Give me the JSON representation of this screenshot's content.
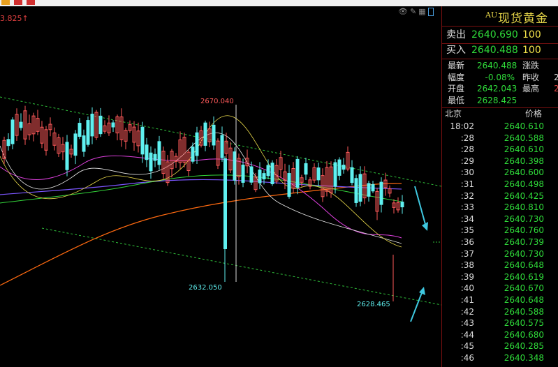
{
  "top_strip": {
    "colors": [
      "#e8a020",
      "#d03030",
      "#d03030"
    ]
  },
  "chart": {
    "top_left_label": "3.825↑",
    "high_label": "2670.040",
    "low_label": "2632.050",
    "low2_label": "2628.465",
    "toolbar_icons": [
      "eye-icon",
      "draw-icon",
      "grid-icon",
      "panel-icon"
    ]
  },
  "panel": {
    "code": "AU",
    "name": "现货黄金",
    "sell": {
      "label": "卖出",
      "price": "2640.690",
      "volume": "100"
    },
    "buy": {
      "label": "买入",
      "price": "2640.488",
      "volume": "100"
    },
    "stats": [
      {
        "l": "最新",
        "v": "2640.488",
        "vcolor": "#2fdc3a",
        "l2": "涨跌",
        "v2": "",
        "v2color": "#2fdc3a"
      },
      {
        "l": "幅度",
        "v": "-0.08%",
        "vcolor": "#2fdc3a",
        "l2": "昨收",
        "v2": "2",
        "v2color": "#dcdcdc"
      },
      {
        "l": "开盘",
        "v": "2642.043",
        "vcolor": "#2fdc3a",
        "l2": "最高",
        "v2": "2",
        "v2color": "#e04040"
      },
      {
        "l": "最低",
        "v": "2628.425",
        "vcolor": "#2fdc3a",
        "l2": "",
        "v2": "",
        "v2color": "#dcdcdc"
      }
    ],
    "table_header": {
      "city": "北京",
      "price": "价格"
    },
    "ticks": [
      {
        "time": "18:02",
        "price": "2640.610"
      },
      {
        "time": ":28",
        "price": "2640.588"
      },
      {
        "time": ":28",
        "price": "2640.610"
      },
      {
        "time": ":29",
        "price": "2640.398"
      },
      {
        "time": ":30",
        "price": "2640.600"
      },
      {
        "time": ":31",
        "price": "2640.498"
      },
      {
        "time": ":32",
        "price": "2640.425"
      },
      {
        "time": ":33",
        "price": "2640.810"
      },
      {
        "time": ":34",
        "price": "2640.730"
      },
      {
        "time": ":35",
        "price": "2640.760"
      },
      {
        "time": ":36",
        "price": "2640.739"
      },
      {
        "time": ":37",
        "price": "2640.730"
      },
      {
        "time": ":38",
        "price": "2640.648"
      },
      {
        "time": ":39",
        "price": "2640.619"
      },
      {
        "time": ":40",
        "price": "2640.670"
      },
      {
        "time": ":41",
        "price": "2640.648"
      },
      {
        "time": ":42",
        "price": "2640.588"
      },
      {
        "time": ":43",
        "price": "2640.575"
      },
      {
        "time": ":44",
        "price": "2640.680"
      },
      {
        "time": ":45",
        "price": "2640.285"
      },
      {
        "time": ":46",
        "price": "2640.348"
      }
    ]
  }
}
